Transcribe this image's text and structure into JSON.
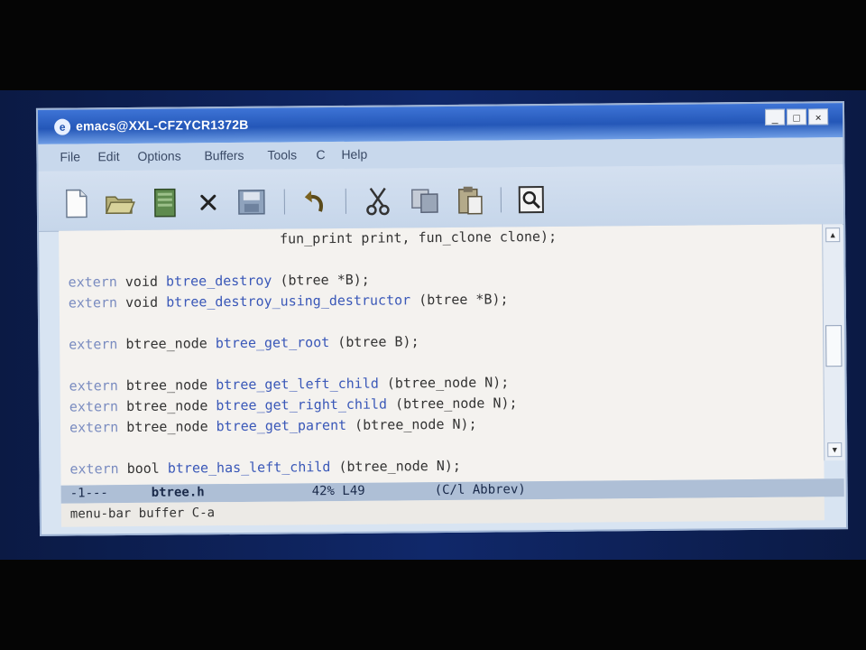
{
  "window": {
    "title": "emacs@XXL-CFZYCR1372B",
    "controls": [
      "_",
      "□",
      "×"
    ]
  },
  "menu": [
    {
      "label": "File"
    },
    {
      "label": "Edit"
    },
    {
      "label": "Options"
    },
    {
      "label": "Buffers"
    },
    {
      "label": "Tools"
    },
    {
      "label": "C"
    },
    {
      "label": "Help"
    }
  ],
  "toolbar": [
    {
      "icon": "new-file-icon"
    },
    {
      "icon": "open-folder-icon"
    },
    {
      "icon": "dired-icon"
    },
    {
      "icon": "close-buffer-icon"
    },
    {
      "icon": "save-icon"
    },
    {
      "icon": "undo-icon"
    },
    {
      "icon": "cut-icon"
    },
    {
      "icon": "copy-icon"
    },
    {
      "icon": "paste-icon"
    },
    {
      "icon": "search-icon"
    }
  ],
  "code": [
    {
      "indent": "                          ",
      "kw": "",
      "type": "",
      "fn": "",
      "rest": "fun_print print, fun_clone clone);"
    },
    {
      "indent": "",
      "kw": "",
      "type": "",
      "fn": "",
      "rest": ""
    },
    {
      "indent": "",
      "kw": "extern",
      "type": " void ",
      "fn": "btree_destroy",
      "rest": " (btree *B);"
    },
    {
      "indent": "",
      "kw": "extern",
      "type": " void ",
      "fn": "btree_destroy_using_destructor",
      "rest": " (btree *B);"
    },
    {
      "indent": "",
      "kw": "",
      "type": "",
      "fn": "",
      "rest": ""
    },
    {
      "indent": "",
      "kw": "extern",
      "type": " btree_node ",
      "fn": "btree_get_root",
      "rest": " (btree B);"
    },
    {
      "indent": "",
      "kw": "",
      "type": "",
      "fn": "",
      "rest": ""
    },
    {
      "indent": "",
      "kw": "extern",
      "type": " btree_node ",
      "fn": "btree_get_left_child",
      "rest": " (btree_node N);"
    },
    {
      "indent": "",
      "kw": "extern",
      "type": " btree_node ",
      "fn": "btree_get_right_child",
      "rest": " (btree_node N);"
    },
    {
      "indent": "",
      "kw": "extern",
      "type": " btree_node ",
      "fn": "btree_get_parent",
      "rest": " (btree_node N);"
    },
    {
      "indent": "",
      "kw": "",
      "type": "",
      "fn": "",
      "rest": ""
    },
    {
      "indent": "",
      "kw": "extern",
      "type": " bool ",
      "fn": "btree_has_left_child",
      "rest": " (btree_node N);"
    }
  ],
  "modeline": {
    "status": "-1---",
    "buffer": "btree.h",
    "position": "42% L49",
    "modes": "(C/l Abbrev)"
  },
  "minibuffer": "menu-bar buffer C-a",
  "colors": {
    "titlebar": "#2457b8",
    "keyword": "#7a8cc0",
    "function": "#3a58b8"
  }
}
